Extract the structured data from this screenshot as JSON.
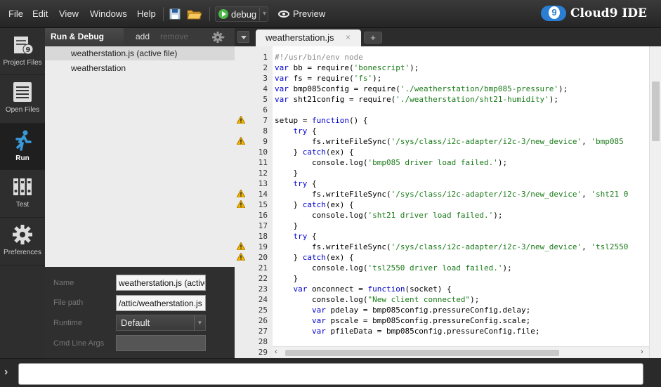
{
  "menubar": {
    "items": [
      "File",
      "Edit",
      "View",
      "Windows",
      "Help"
    ],
    "debug_label": "debug",
    "preview_label": "Preview",
    "brand": "Cloud9 IDE",
    "brand_glyph": "9"
  },
  "leftnav": {
    "items": [
      {
        "label": "Project Files",
        "icon": "project-files-icon"
      },
      {
        "label": "Open Files",
        "icon": "open-files-icon"
      },
      {
        "label": "Run",
        "icon": "run-icon",
        "active": true
      },
      {
        "label": "Test",
        "icon": "test-icon"
      },
      {
        "label": "Preferences",
        "icon": "gear-icon"
      }
    ]
  },
  "panel": {
    "title": "Run & Debug",
    "add": "add",
    "remove": "remove",
    "configs": [
      "weatherstation.js (active file)",
      "weatherstation"
    ],
    "form": {
      "name_label": "Name",
      "name_value": "weatherstation.js (active",
      "filepath_label": "File path",
      "filepath_value": "/attic/weatherstation.js",
      "runtime_label": "Runtime",
      "runtime_value": "Default",
      "args_label": "Cmd Line Args",
      "args_value": ""
    }
  },
  "editor": {
    "tab_name": "weatherstation.js",
    "tab_close": "×",
    "tab_add": "+",
    "warning_lines": [
      7,
      9,
      14,
      15,
      19,
      20
    ],
    "lines": [
      "#!/usr/bin/env node",
      "var bb = require('bonescript');",
      "var fs = require('fs');",
      "var bmp085config = require('./weatherstation/bmp085-pressure');",
      "var sht21config = require('./weatherstation/sht21-humidity');",
      "",
      "setup = function() {",
      "    try {",
      "        fs.writeFileSync('/sys/class/i2c-adapter/i2c-3/new_device', 'bmp085",
      "    } catch(ex) {",
      "        console.log('bmp085 driver load failed.');",
      "    }",
      "    try {",
      "        fs.writeFileSync('/sys/class/i2c-adapter/i2c-3/new_device', 'sht21 0",
      "    } catch(ex) {",
      "        console.log('sht21 driver load failed.');",
      "    }",
      "    try {",
      "        fs.writeFileSync('/sys/class/i2c-adapter/i2c-3/new_device', 'tsl2550",
      "    } catch(ex) {",
      "        console.log('tsl2550 driver load failed.');",
      "    }",
      "    var onconnect = function(socket) {",
      "        console.log(\"New client connected\");",
      "        var pdelay = bmp085config.pressureConfig.delay;",
      "        var pscale = bmp085config.pressureConfig.scale;",
      "        var pfileData = bmp085config.pressureConfig.file;",
      "",
      ""
    ]
  },
  "console": {
    "toggle": "›",
    "value": ""
  },
  "colors": {
    "accent": "#2a7fd4",
    "run_green": "#4cb848",
    "warning": "#f0b400"
  }
}
